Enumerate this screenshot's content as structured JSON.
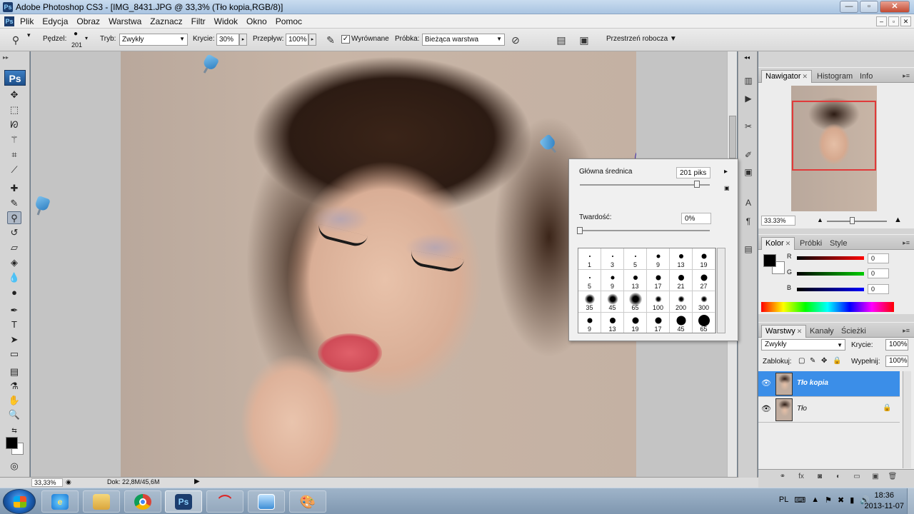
{
  "window": {
    "title": "Adobe Photoshop CS3 - [IMG_8431.JPG @ 33,3% (Tło kopia,RGB/8)]",
    "app_icon": "Ps",
    "minimize": "—",
    "maximize": "▫",
    "close": "✕"
  },
  "menu": {
    "items": [
      "Plik",
      "Edycja",
      "Obraz",
      "Warstwa",
      "Zaznacz",
      "Filtr",
      "Widok",
      "Okno",
      "Pomoc"
    ]
  },
  "options": {
    "brush_label": "Pędzel:",
    "brush_size": "201",
    "mode_label": "Tryb:",
    "mode_value": "Zwykły",
    "opacity_label": "Krycie:",
    "opacity_value": "30%",
    "flow_label": "Przepływ:",
    "flow_value": "100%",
    "aligned_label": "Wyrównane",
    "aligned_checked": true,
    "sample_label": "Próbka:",
    "sample_value": "Bieżąca warstwa",
    "workspace_label": "Przestrzeń robocza"
  },
  "tools": {
    "logo": "Ps",
    "items": [
      "move-tool",
      "marquee-tool",
      "lasso-tool",
      "magic-wand-tool",
      "crop-tool",
      "slice-tool",
      "healing-brush-tool",
      "brush-tool",
      "clone-stamp-tool",
      "history-brush-tool",
      "eraser-tool",
      "paint-bucket-tool",
      "blur-tool",
      "dodge-tool",
      "pen-tool",
      "type-tool",
      "path-selection-tool",
      "shape-tool",
      "notes-tool",
      "eyedropper-tool",
      "hand-tool",
      "zoom-tool"
    ],
    "active": "clone-stamp-tool",
    "foreground_color": "#000000",
    "background_color": "#ffffff"
  },
  "brush_popup": {
    "diameter_label": "Główna średnica",
    "diameter_value": "201 piks",
    "diameter_level": 0.9,
    "hardness_label": "Twardość:",
    "hardness_value": "0%",
    "hardness_level": 0.0,
    "presets": [
      {
        "size": "1"
      },
      {
        "size": "3"
      },
      {
        "size": "5"
      },
      {
        "size": "9"
      },
      {
        "size": "13"
      },
      {
        "size": "19"
      },
      {
        "size": "5"
      },
      {
        "size": "9"
      },
      {
        "size": "13"
      },
      {
        "size": "17"
      },
      {
        "size": "21"
      },
      {
        "size": "27"
      },
      {
        "size": "35"
      },
      {
        "size": "45"
      },
      {
        "size": "65"
      },
      {
        "size": "100"
      },
      {
        "size": "200"
      },
      {
        "size": "300"
      },
      {
        "size": "9"
      },
      {
        "size": "13"
      },
      {
        "size": "19"
      },
      {
        "size": "17"
      },
      {
        "size": "45"
      },
      {
        "size": "65"
      }
    ]
  },
  "status": {
    "zoom": "33,33%",
    "doc": "Dok: 22,8M/45,6M"
  },
  "navigator": {
    "tabs": [
      "Nawigator",
      "Histogram",
      "Info"
    ],
    "active_tab": "Nawigator",
    "zoom": "33.33%"
  },
  "color_panel": {
    "tabs": [
      "Kolor",
      "Próbki",
      "Style"
    ],
    "active_tab": "Kolor",
    "r_label": "R",
    "r_value": "0",
    "g_label": "G",
    "g_value": "0",
    "b_label": "B",
    "b_value": "0"
  },
  "layers_panel": {
    "tabs": [
      "Warstwy",
      "Kanały",
      "Ścieżki"
    ],
    "active_tab": "Warstwy",
    "blend_mode": "Zwykły",
    "opacity_label": "Krycie:",
    "opacity_value": "100%",
    "lock_label": "Zablokuj:",
    "fill_label": "Wypełnij:",
    "fill_value": "100%",
    "layers": [
      {
        "name": "Tło kopia",
        "selected": true,
        "locked": false
      },
      {
        "name": "Tło",
        "selected": false,
        "locked": true
      }
    ]
  },
  "taskbar": {
    "apps": [
      "Internet Explorer",
      "Eksplorator Windows",
      "Google Chrome",
      "Photoshop",
      "Adobe",
      "Pulpit",
      "Paint"
    ],
    "active_app": "Photoshop",
    "lang": "PL",
    "time": "18:36",
    "date": "2013-11-07"
  }
}
